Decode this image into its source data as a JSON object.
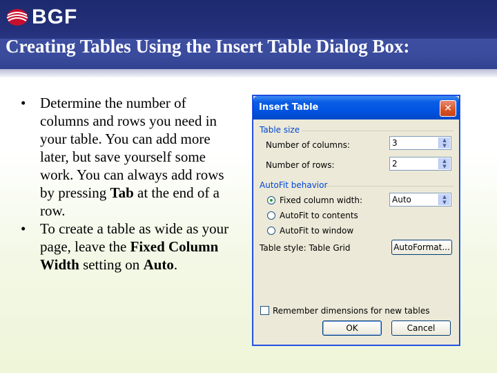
{
  "header": {
    "logo_text": "BGF",
    "slide_title": "Creating Tables Using the Insert Table Dialog Box:"
  },
  "bullets": {
    "b1_pre": "Determine the number of columns and rows you need in your table. You can add more later, but save yourself some work. You can always add rows by pressing ",
    "b1_bold": "Tab",
    "b1_post": " at the end of a row.",
    "b2_pre": "To create a table as wide as your page, leave the ",
    "b2_bold1": "Fixed Column Width",
    "b2_mid": " setting on ",
    "b2_bold2": "Auto",
    "b2_post": "."
  },
  "dialog": {
    "title": "Insert Table",
    "close_glyph": "✕",
    "table_size_label": "Table size",
    "columns_label": "Number of columns:",
    "columns_value": "3",
    "rows_label": "Number of rows:",
    "rows_value": "2",
    "autofit_label": "AutoFit behavior",
    "fixed_width_label": "Fixed column width:",
    "fixed_width_value": "Auto",
    "autofit_contents_label": "AutoFit to contents",
    "autofit_window_label": "AutoFit to window",
    "table_style_label": "Table style:  Table Grid",
    "autoformat_label": "AutoFormat...",
    "remember_label": "Remember dimensions for new tables",
    "ok_label": "OK",
    "cancel_label": "Cancel"
  },
  "colors": {
    "header_blue": "#24307a",
    "dialog_face": "#ece9d8",
    "title_blue": "#0054e3",
    "group_blue": "#0046d5"
  }
}
